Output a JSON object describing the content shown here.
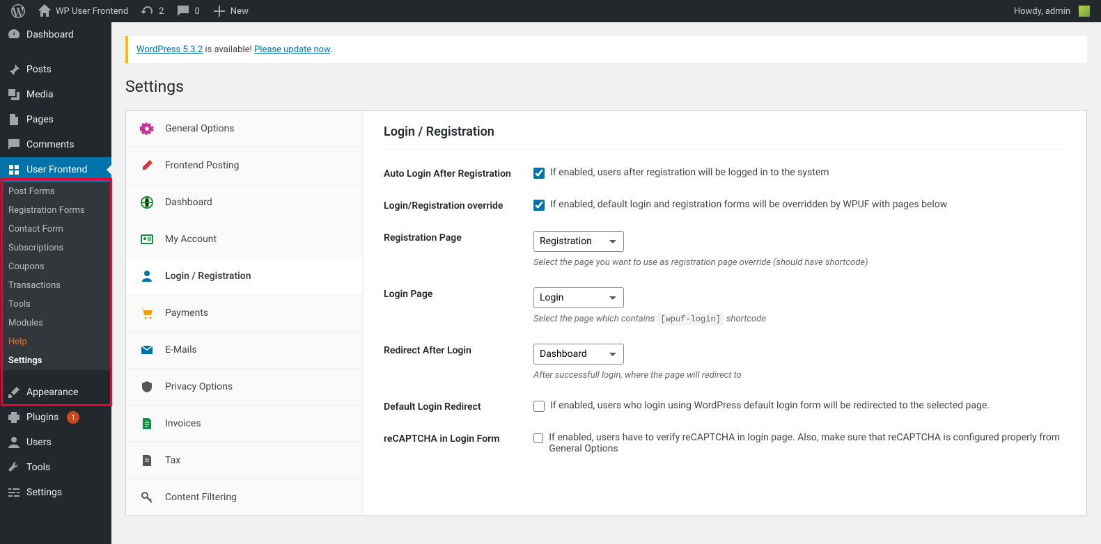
{
  "adminbar": {
    "site_name": "WP User Frontend",
    "updates_count": "2",
    "comments_count": "0",
    "new_label": "New",
    "howdy": "Howdy, admin"
  },
  "sidebar": {
    "dashboard": "Dashboard",
    "posts": "Posts",
    "media": "Media",
    "pages": "Pages",
    "comments": "Comments",
    "user_frontend": "User Frontend",
    "uf_sub": {
      "post_forms": "Post Forms",
      "registration_forms": "Registration Forms",
      "contact_form": "Contact Form",
      "subscriptions": "Subscriptions",
      "coupons": "Coupons",
      "transactions": "Transactions",
      "tools": "Tools",
      "modules": "Modules",
      "help": "Help",
      "settings": "Settings"
    },
    "appearance": "Appearance",
    "plugins": "Plugins",
    "plugins_count": "1",
    "users": "Users",
    "tools": "Tools",
    "settings": "Settings"
  },
  "notice": {
    "pre": "WordPress 5.3.2",
    "mid": " is available! ",
    "link": "Please update now"
  },
  "page_title": "Settings",
  "tabs": {
    "general": "General Options",
    "frontend_posting": "Frontend Posting",
    "dashboard": "Dashboard",
    "my_account": "My Account",
    "login_reg": "Login / Registration",
    "payments": "Payments",
    "emails": "E-Mails",
    "privacy": "Privacy Options",
    "invoices": "Invoices",
    "tax": "Tax",
    "content_filtering": "Content Filtering"
  },
  "panel": {
    "heading": "Login / Registration",
    "auto_login": {
      "label": "Auto Login After Registration",
      "text": "If enabled, users after registration will be logged in to the system"
    },
    "override": {
      "label": "Login/Registration override",
      "text": "If enabled, default login and registration forms will be overridden by WPUF with pages below"
    },
    "reg_page": {
      "label": "Registration Page",
      "value": "Registration",
      "desc": "Select the page you want to use as registration page override (should have shortcode)"
    },
    "login_page": {
      "label": "Login Page",
      "value": "Login",
      "desc_pre": "Select the page which contains ",
      "code": "[wpuf-login]",
      "desc_post": " shortcode"
    },
    "redirect_after": {
      "label": "Redirect After Login",
      "value": "Dashboard",
      "desc": "After successfull login, where the page will redirect to"
    },
    "default_redirect": {
      "label": "Default Login Redirect",
      "text": "If enabled, users who login using WordPress default login form will be redirected to the selected page."
    },
    "recaptcha": {
      "label": "reCAPTCHA in Login Form",
      "text": "If enabled, users have to verify reCAPTCHA in login page. Also, make sure that reCAPTCHA is configured properly from General Options"
    }
  }
}
